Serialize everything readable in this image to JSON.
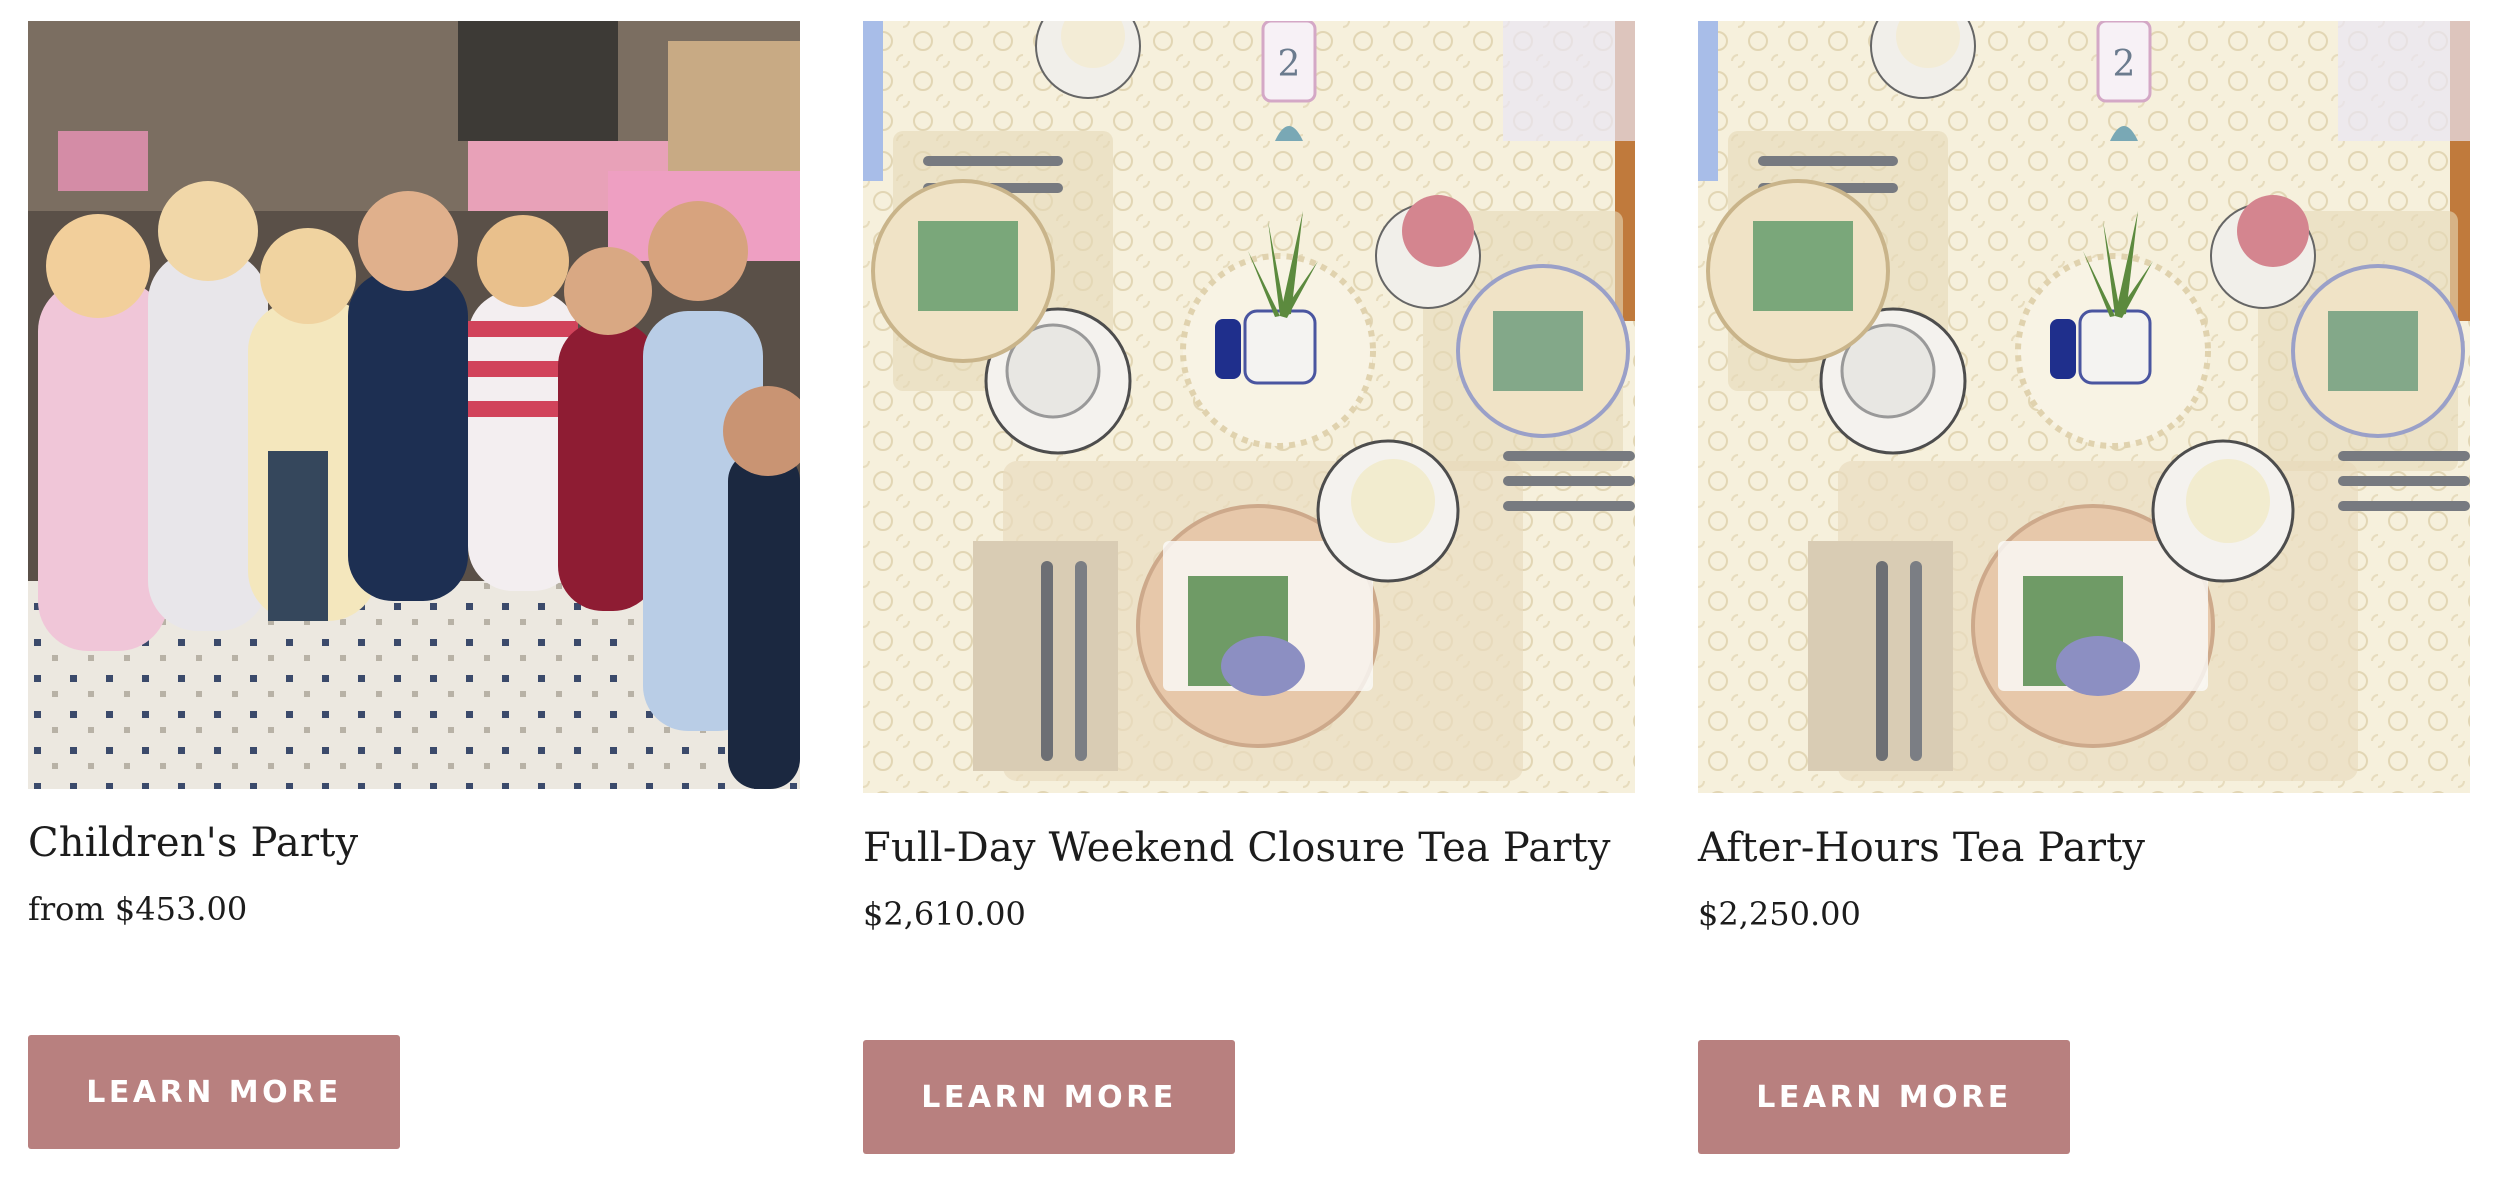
{
  "products": [
    {
      "title": "Children's Party",
      "price": "from $453.00",
      "button_label": "LEARN MORE",
      "image": "children-party-photo"
    },
    {
      "title": "Full-Day Weekend Closure Tea Party",
      "price": "$2,610.00",
      "button_label": "LEARN MORE",
      "image": "tea-table-photo"
    },
    {
      "title": "After-Hours Tea Party",
      "price": "$2,250.00",
      "button_label": "LEARN MORE",
      "image": "tea-table-photo"
    }
  ],
  "colors": {
    "button_bg": "#b8807f",
    "button_text": "#ffffff",
    "title_text": "#1c1c1c"
  }
}
